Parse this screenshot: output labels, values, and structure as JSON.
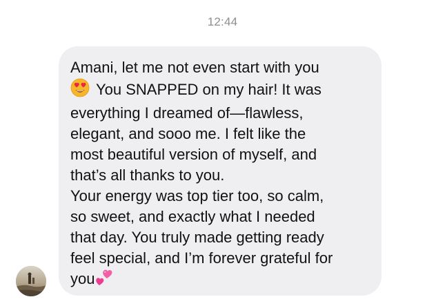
{
  "thread": {
    "timestamp": "12:44"
  },
  "message": {
    "sender_avatar_icon": "profile-photo",
    "emoji_1": "heart-eyes-emoji",
    "emoji_2": "two-hearts-emoji",
    "paragraph_1": {
      "line_1": "Amani, let me not even start with you",
      "line_2": "You SNAPPED on my hair! It was",
      "line_3": "everything I dreamed of—flawless,",
      "line_4": "elegant, and sooo me. I felt like the",
      "line_5": "most beautiful version of myself, and",
      "line_6": "that’s all thanks to you."
    },
    "paragraph_2": {
      "line_1": "Your energy was top tier too, so calm,",
      "line_2": "so sweet, and exactly what I needed",
      "line_3": "that day. You truly made getting ready",
      "line_4": "feel special, and I’m forever grateful for",
      "line_5": "you"
    }
  },
  "colors": {
    "bubble_background": "#efeff1",
    "timestamp_text": "#8e8e93",
    "message_text": "#111111"
  }
}
